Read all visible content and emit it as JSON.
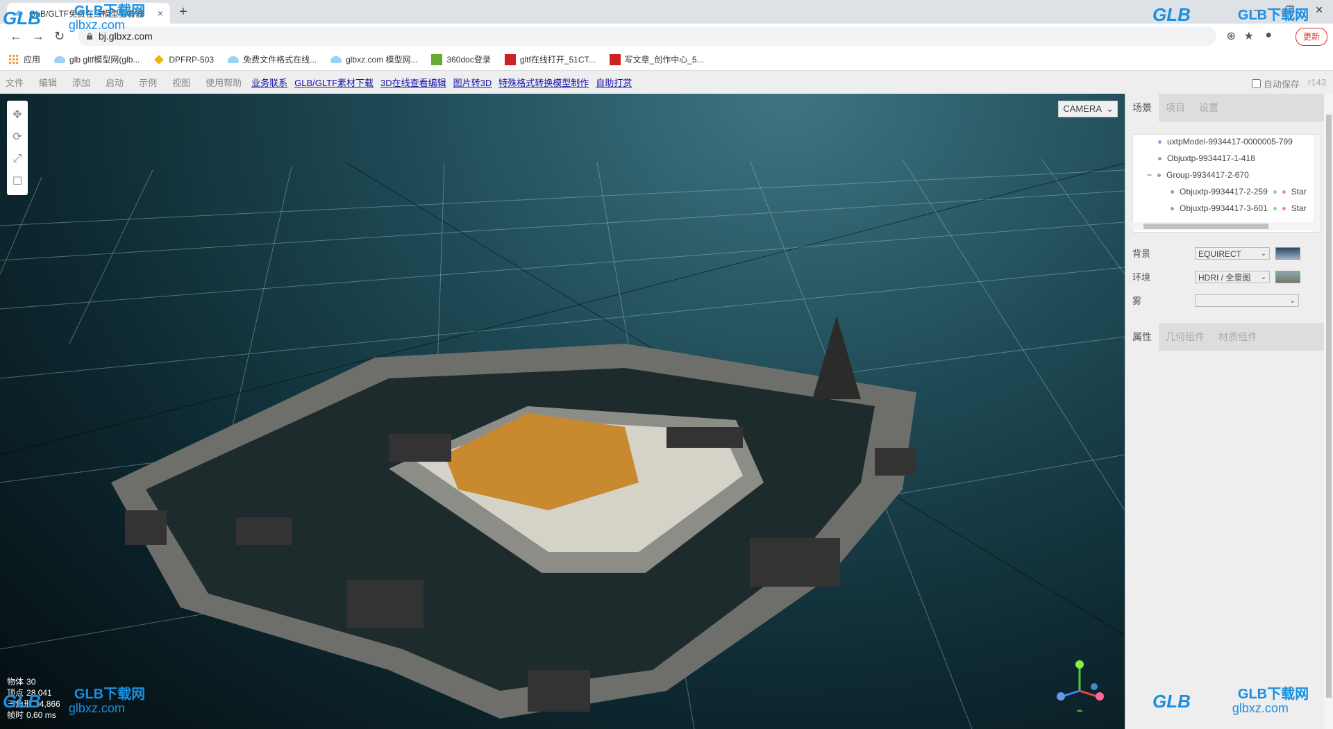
{
  "browser": {
    "tab_title": "GLB/GLTF免费在线模型查看器",
    "url": "bj.glbxz.com",
    "update_label": "更新",
    "bookmarks": [
      {
        "label": "应用",
        "icon": "apps-grid-icon"
      },
      {
        "label": "glb gltf模型网(glb...",
        "icon": "cloud-icon"
      },
      {
        "label": "DPFRP-503",
        "icon": "diamond-icon"
      },
      {
        "label": "免费文件格式在线...",
        "icon": "cloud-icon"
      },
      {
        "label": "glbxz.com 模型网...",
        "icon": "cloud-icon"
      },
      {
        "label": "360doc登录",
        "icon": "doc-icon"
      },
      {
        "label": "gltf在线打开_51CT...",
        "icon": "51cto-icon"
      },
      {
        "label": "写文章_创作中心_5...",
        "icon": "51cto-icon"
      }
    ]
  },
  "editor": {
    "menus": [
      "文件",
      "编辑",
      "添加",
      "启动",
      "示例",
      "视图",
      "使用帮助"
    ],
    "links": [
      "业务联系",
      "GLB/GLTF素材下载",
      "3D在线查看编辑",
      "图片转3D",
      "特殊格式转换模型制作",
      "自助打赏"
    ],
    "autosave_label": "自动保存",
    "revision": "r143",
    "camera": "CAMERA",
    "stats": {
      "objects_label": "物体",
      "objects": "30",
      "vertices_label": "顶点",
      "vertices": "28,041",
      "triangles_label": "三角形",
      "triangles": "14,866",
      "frame_label": "帧时",
      "frame": "0.60 ms"
    }
  },
  "sidebar": {
    "tabs": [
      "场景",
      "项目",
      "设置"
    ],
    "outliner": [
      {
        "label": "uxtpModel-9934417-0000005-799",
        "indent": 1
      },
      {
        "label": "Objuxtp-9934417-1-418",
        "indent": 1
      },
      {
        "label": "Group-9934417-2-670",
        "indent": 1,
        "toggle": "−"
      },
      {
        "label": "Objuxtp-9934417-2-259",
        "indent": 2,
        "extra": "Star"
      },
      {
        "label": "Objuxtp-9934417-3-601",
        "indent": 2,
        "extra": "Star"
      }
    ],
    "background_label": "背景",
    "background_value": "EQUIRECT",
    "environment_label": "环境",
    "environment_value": "HDRI / 全景图",
    "fog_label": "雾",
    "fog_value": "",
    "prop_tabs": [
      "属性",
      "几何组件",
      "材质组件"
    ]
  },
  "watermark": {
    "brand": "GLB",
    "zh": "GLB下载网",
    "domain": "glbxz.com"
  },
  "colors": {
    "accent": "#1a8fe0",
    "link": "#1a0dab",
    "update": "#d93025"
  }
}
